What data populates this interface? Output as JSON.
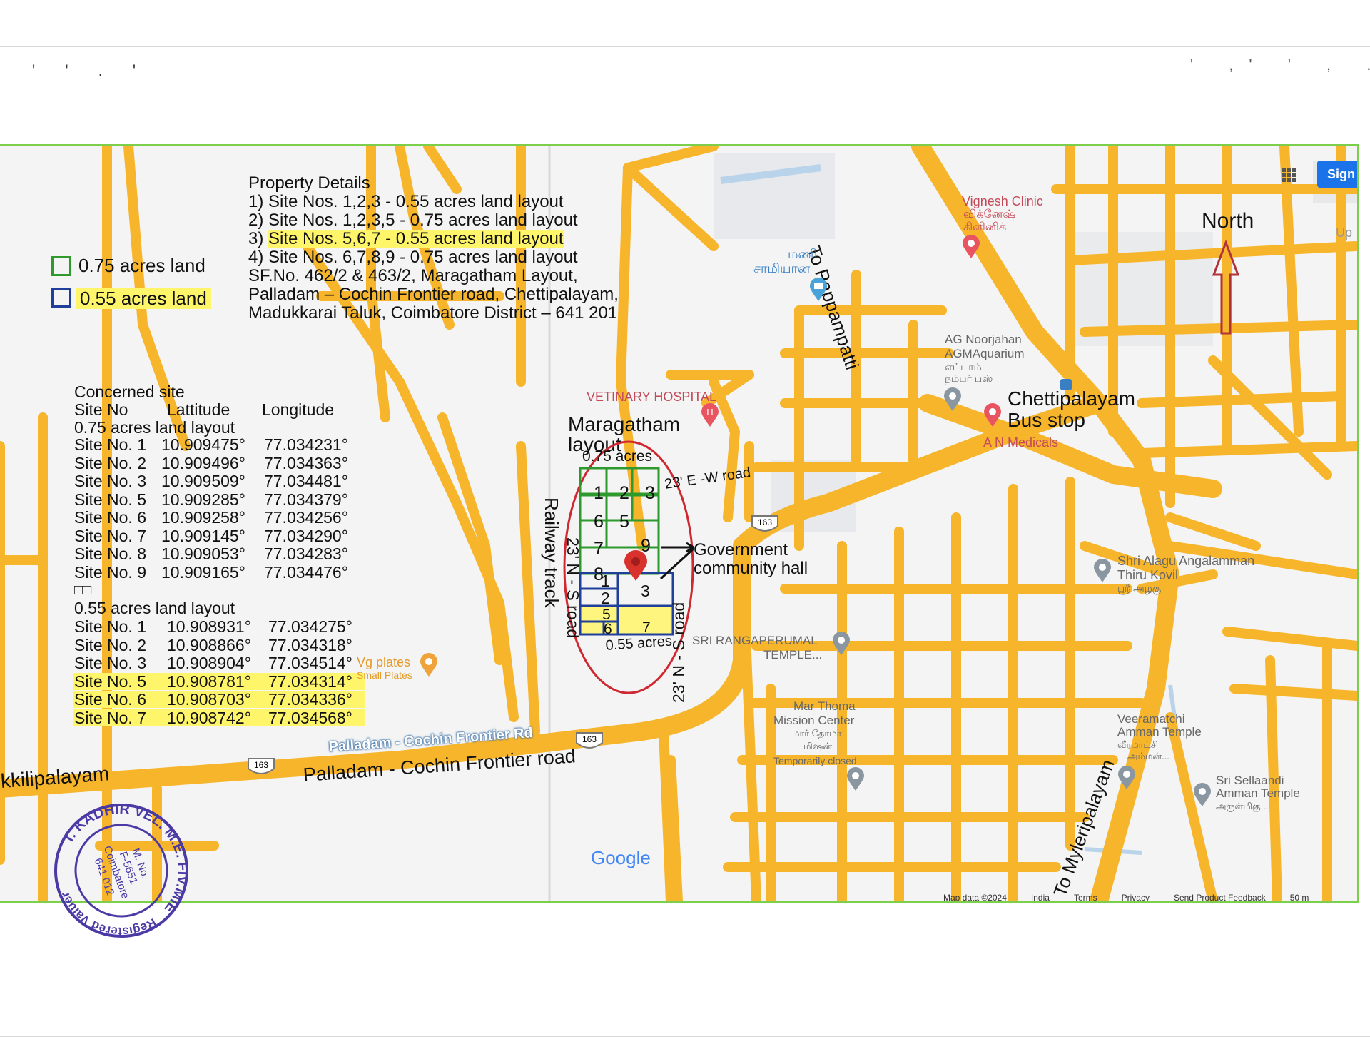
{
  "scan_marks": {
    "left": "' ' . '",
    "right": "' ,' ' , .'"
  },
  "legend": {
    "green_label": "0.75 acres land",
    "blue_label": "0.55 acres land",
    "green_color": "#2e9a2e",
    "blue_color": "#1f3f9a"
  },
  "property": {
    "title": "Property Details",
    "lines": [
      "1) Site Nos. 1,2,3 - 0.55 acres land layout",
      "2) Site Nos. 1,2,3,5 - 0.75 acres land layout",
      "3) Site Nos. 5,6,7 - 0.55 acres land layout",
      "4) Site Nos. 6,7,8,9 - 0.75 acres land layout",
      "SF.No. 462/2 & 463/2, Maragatham Layout,",
      "Palladam – Cochin Frontier road, Chettipalayam,",
      "Madukkarai Taluk, Coimbatore District – 641 201"
    ]
  },
  "coords": {
    "title": "Concerned site",
    "headers": [
      "Site No",
      "Lattitude",
      "Longitude"
    ],
    "group1_title": "0.75 acres land layout",
    "group1": [
      {
        "site": "Site No. 1",
        "lat": "10.909475°",
        "lon": "77.034231°"
      },
      {
        "site": "Site No. 2",
        "lat": "10.909496°",
        "lon": "77.034363°"
      },
      {
        "site": "Site No. 3",
        "lat": "10.909509°",
        "lon": "77.034481°"
      },
      {
        "site": "Site No. 5",
        "lat": "10.909285°",
        "lon": "77.034379°"
      },
      {
        "site": "Site No. 6",
        "lat": "10.909258°",
        "lon": "77.034256°"
      },
      {
        "site": "Site No. 7",
        "lat": "10.909145°",
        "lon": "77.034290°"
      },
      {
        "site": "Site No. 8",
        "lat": "10.909053°",
        "lon": "77.034283°"
      },
      {
        "site": "Site No. 9",
        "lat": "10.909165°",
        "lon": "77.034476°"
      }
    ],
    "boxes": "□□",
    "group2_title": "0.55 acres land layout",
    "group2": [
      {
        "site": "Site No. 1",
        "lat": "10.908931°",
        "lon": "77.034275°"
      },
      {
        "site": "Site No. 2",
        "lat": "10.908866°",
        "lon": "77.034318°"
      },
      {
        "site": "Site No. 3",
        "lat": "10.908904°",
        "lon": "77.034514°"
      },
      {
        "site": "Site No. 5",
        "lat": "10.908781°",
        "lon": "77.034314°"
      },
      {
        "site": "Site No. 6",
        "lat": "10.908703°",
        "lon": "77.034336°"
      },
      {
        "site": "Site No. 7",
        "lat": "10.908742°",
        "lon": "77.034568°"
      }
    ]
  },
  "map": {
    "road_color": "#f7b52b",
    "north": "North",
    "to_pappampatti": "To Pappampatti",
    "to_myleripalayam": "To Myleripalayam",
    "vignesh_en": "Vignesh Clinic",
    "vignesh_ta1": "விக்னேஷ்",
    "vignesh_ta2": "கிளினிக்",
    "mani1": "மணி",
    "mani2": "சாமியான",
    "ag1": "AG Noorjahan",
    "ag2": "AGMAquarium",
    "ag3": "எட்டாம்",
    "ag4": "நம்பர் பஸ்",
    "busstop1": "Chettipalayam",
    "busstop2": "Bus stop",
    "medicals": "A N Medicals",
    "vet": "VETINARY HOSPITAL",
    "maragatham1": "Maragatham",
    "maragatham2": "layout",
    "acres075": "0.75 acres",
    "acres055": "0.55 acres",
    "ew_road": "23' E -W road",
    "ns_road1": "23' N - S road",
    "ns_road2": "23' N - S road",
    "railway": "Railway track",
    "gov1": "Government",
    "gov2": "community hall",
    "alagu1": "Shri Alagu Angalamman",
    "alagu2": "Thiru Kovil",
    "alagu3": "ஸ்ரீ அழகு",
    "ranga1": "SRI RANGAPERUMAL",
    "ranga2": "TEMPLE...",
    "mar1": "Mar Thoma",
    "mar2": "Mission Center",
    "mar3": "மார் தோமா",
    "mar4": "மிஷன்",
    "mar5": "Temporarily closed",
    "veera1": "Veeramatchi",
    "veera2": "Amman Temple",
    "veera3": "வீரமாட்சி",
    "veera4": "அம்மன்...",
    "sella1": "Sri Sellaandi",
    "sella2": "Amman Temple",
    "sella3": "அருள்மிகு...",
    "vg1": "Vg plates",
    "vg2": "Small Plates",
    "kkili": "kkilipalayam",
    "palladam_label": "Palladam - Cochin Frontier Rd",
    "palladam_road": "Palladam - Cochin Frontier road",
    "shield": "163",
    "google": "Google",
    "sign": "Sign",
    "up": "Up",
    "footer": [
      "Map data ©2024",
      "India",
      "Terms",
      "Privacy",
      "Send Product Feedback",
      "50 m"
    ]
  },
  "plots": {
    "green": [
      "1",
      "2",
      "3",
      "6",
      "5",
      "7",
      "9",
      "8"
    ],
    "blue": [
      "1",
      "2",
      "3"
    ],
    "yellow": [
      "5",
      "6",
      "7"
    ]
  },
  "stamp": {
    "name": "T. KADHIR VEL. M.E. FIV.MIE",
    "mno": "M. No.",
    "fno": "F-5651",
    "city": "Coimbatore",
    "pin": "641 012",
    "role": "Registered Valuer"
  }
}
